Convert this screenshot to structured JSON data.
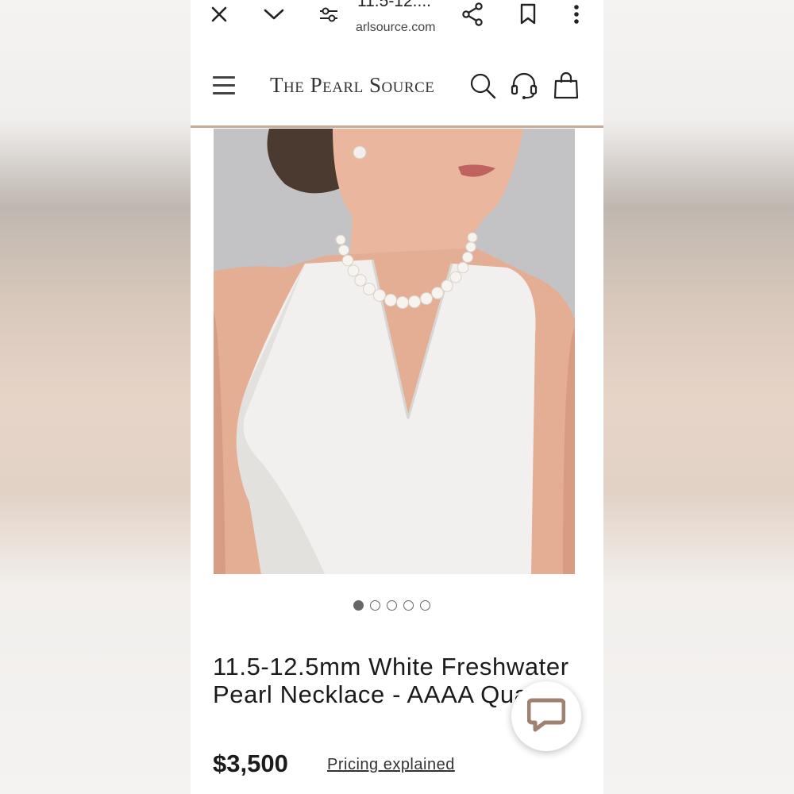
{
  "browser": {
    "tab_title": "11.5-12....",
    "domain": "arlsource.com"
  },
  "site": {
    "logo": "The Pearl Source"
  },
  "carousel": {
    "slide_count": 5,
    "active_index": 0
  },
  "product": {
    "title": "11.5-12.5mm White Freshwater Pearl Necklace - AAAA Quality",
    "price": "$3,500",
    "pricing_link": "Pricing explained"
  },
  "icons": {
    "close": "close-icon",
    "chevron": "chevron-down-icon",
    "tune": "tune-icon",
    "share": "share-icon",
    "bookmark": "bookmark-icon",
    "more": "more-vert-icon",
    "menu": "hamburger-icon",
    "search": "search-icon",
    "support": "headset-icon",
    "bag": "shopping-bag-icon",
    "chat": "chat-icon"
  },
  "colors": {
    "header_rule": "#c9aa99",
    "chat_icon": "#a0806f"
  }
}
